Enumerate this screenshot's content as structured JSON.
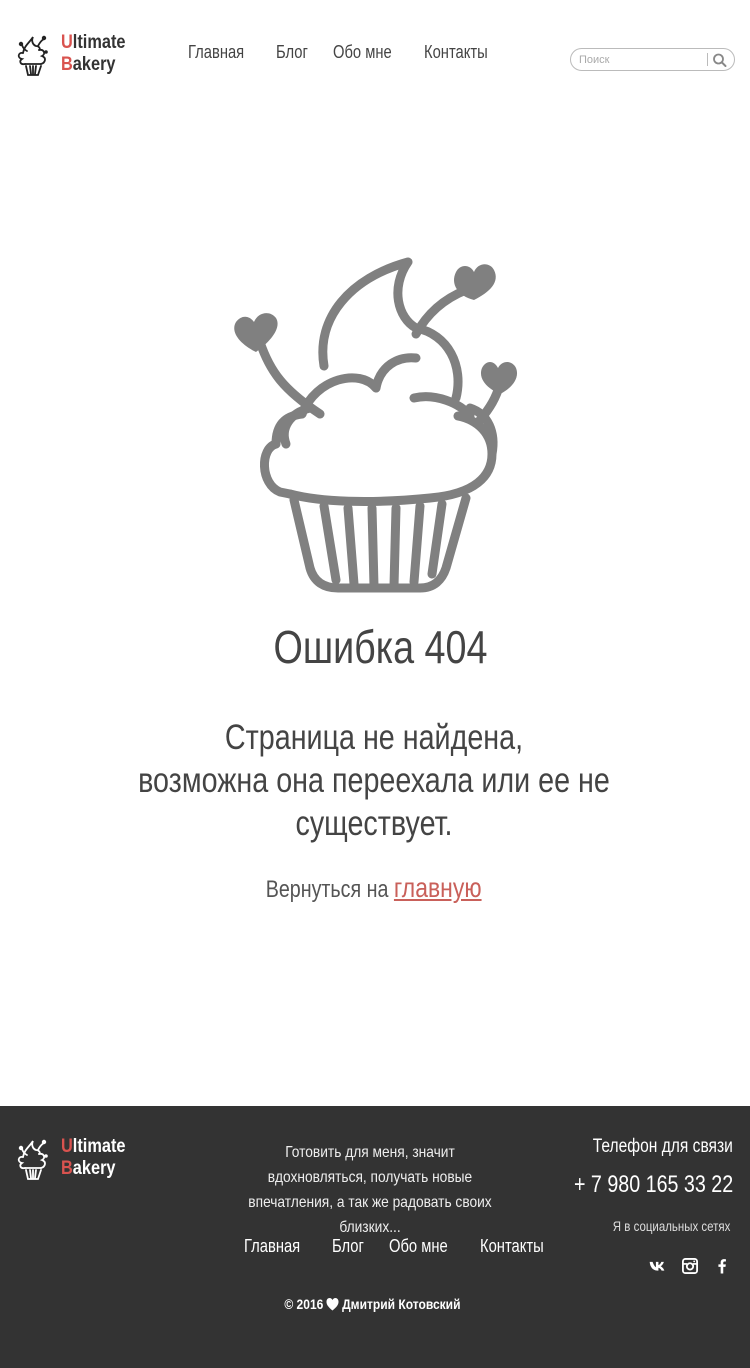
{
  "brand": {
    "name_line1_accent": "U",
    "name_line1_rest": "ltimate",
    "name_line2_accent": "B",
    "name_line2_rest": "akery"
  },
  "nav": {
    "items": [
      {
        "label": "Главная"
      },
      {
        "label": "Блог"
      },
      {
        "label": "Обо мне"
      },
      {
        "label": "Контакты"
      }
    ]
  },
  "search": {
    "placeholder": "Поиск"
  },
  "error": {
    "title": "Ошибка 404",
    "line1": "Страница не найдена,",
    "line2": "возможна она переехала или ее не существует.",
    "back_prefix": "Вернуться на",
    "back_link": "главную"
  },
  "footer": {
    "about": "Готовить для меня, значит вдохновляться, получать новые впечатления, а так же радовать своих близких...",
    "nav": [
      {
        "label": "Главная"
      },
      {
        "label": "Блог"
      },
      {
        "label": "Обо мне"
      },
      {
        "label": "Контакты"
      }
    ],
    "phone_label": "Телефон для связи",
    "phone": "+ 7 980 165 33 22",
    "social_label": "Я в социальных сетях",
    "social": [
      {
        "icon": "vk-icon"
      },
      {
        "icon": "instagram-icon"
      },
      {
        "icon": "facebook-icon"
      }
    ],
    "copyright_prefix": "© 2016",
    "copyright_name": "Дмитрий Котовский"
  },
  "colors": {
    "accent": "#d9534f",
    "link": "#c9605a",
    "footer_bg": "#333333",
    "illustration": "#808080"
  }
}
